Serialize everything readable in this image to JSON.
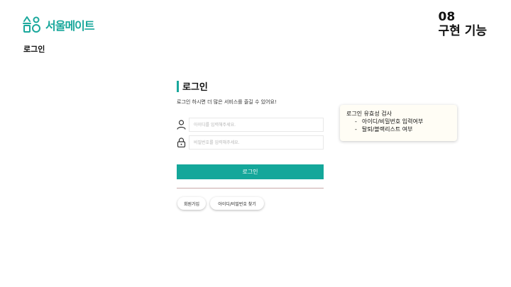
{
  "brand": {
    "name": "서울메이트",
    "accent": "#1aa89c"
  },
  "page_label": "로그인",
  "section": {
    "number": "08",
    "title": "구현 기능",
    "highlight": "#fff200"
  },
  "login": {
    "heading": "로그인",
    "subtitle": "로그인 하시면 더 많은 서비스를 즐길 수 있어요!",
    "id_placeholder": "아이디를 입력해주세요.",
    "password_placeholder": "비밀번호를 입력해주세요.",
    "id_icon": "user-icon",
    "password_icon": "lock-icon",
    "submit_label": "로그인",
    "signup_label": "회원가입",
    "find_label": "아이디/비밀번호 찾기"
  },
  "note": {
    "title": "로그인 유효성 검사",
    "items": [
      {
        "bullet": "-",
        "text": "아이디/비밀번호 입력여부"
      },
      {
        "bullet": "-",
        "text": "탈퇴/블랙리스트 여부"
      }
    ]
  }
}
